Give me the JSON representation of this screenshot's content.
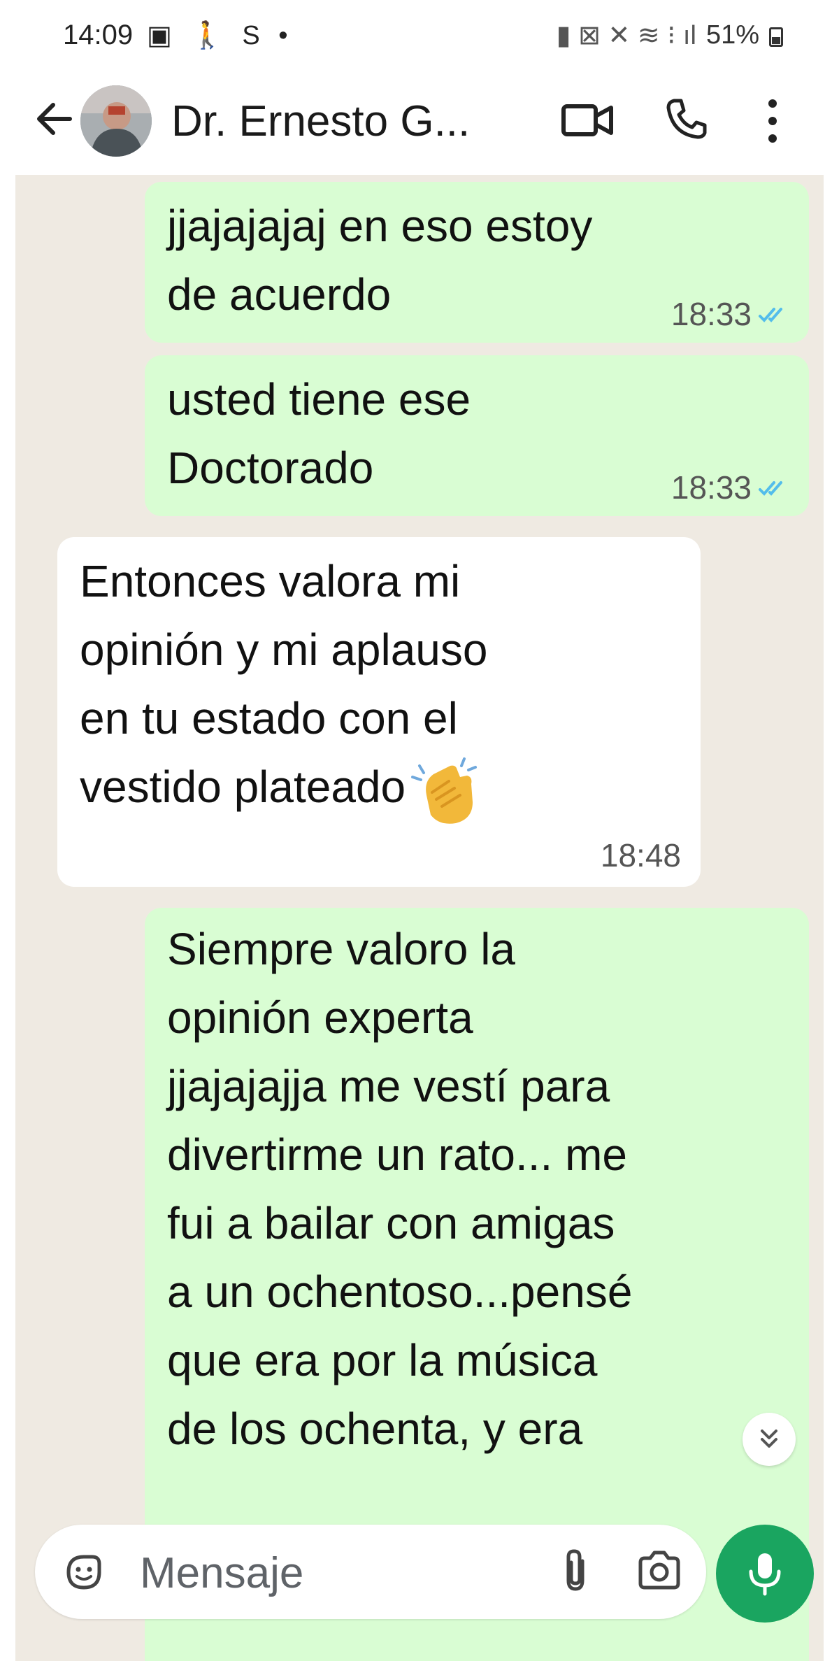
{
  "status_bar": {
    "time": "14:09",
    "left_icons": "▣ 🚶 S •",
    "battery": "51%"
  },
  "header": {
    "contact_name": "Dr. Ernesto G...",
    "icons": [
      "back-arrow-icon",
      "avatar",
      "video-call-icon",
      "phone-icon",
      "more-options-icon"
    ]
  },
  "messages": [
    {
      "direction": "outgoing",
      "text": "jjajajajaj en eso estoy\nde acuerdo",
      "time": "18:33",
      "status": "read"
    },
    {
      "direction": "outgoing",
      "text": "usted tiene ese\nDoctorado",
      "time": "18:33",
      "status": "read"
    },
    {
      "direction": "incoming",
      "text": "Entonces valora mi\nopinión y mi aplauso\nen tu estado con el\nvestido plateado",
      "emoji": "clapping-hands",
      "time": "18:48"
    },
    {
      "direction": "outgoing",
      "text": "Siempre valoro la\nopinión experta\njjajajajja me vestí para\ndivertirme un rato... me\nfui a bailar con amigas\na un ochentoso...pensé\nque era por la música\nde los ochenta, y era"
    }
  ],
  "composer": {
    "placeholder": "Mensaje"
  },
  "colors": {
    "outgoing_bubble": "#d9fdd3",
    "incoming_bubble": "#ffffff",
    "chat_background": "#efeae2",
    "mic_button": "#1aa560",
    "read_ticks": "#53bdeb"
  }
}
